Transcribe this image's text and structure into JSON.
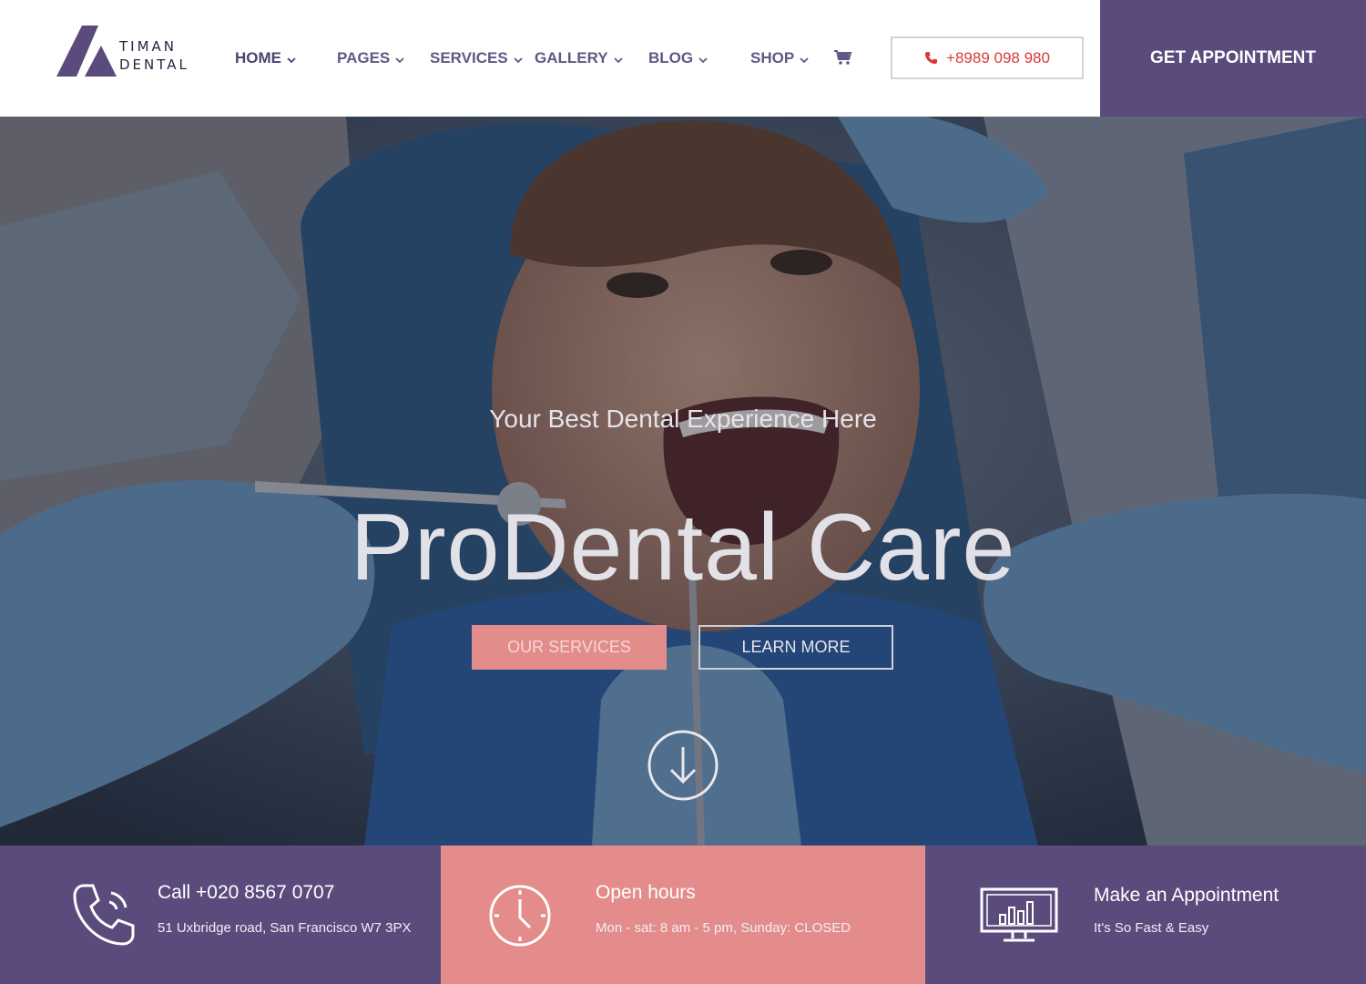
{
  "brand": {
    "line1": "TIMAN",
    "line2": "DENTAL"
  },
  "nav": {
    "items": [
      {
        "label": "HOME"
      },
      {
        "label": "PAGES"
      },
      {
        "label": "SERVICES"
      },
      {
        "label": "GALLERY"
      },
      {
        "label": "BLOG"
      },
      {
        "label": "SHOP"
      }
    ],
    "cart_icon": "cart-icon"
  },
  "header": {
    "phone": "+8989 098 980",
    "appointment_label": "GET APPOINTMENT"
  },
  "hero": {
    "subtitle": "Your Best Dental Experience Here",
    "title": "ProDental Care",
    "primary_button": "OUR SERVICES",
    "secondary_button": "LEARN MORE"
  },
  "info": {
    "call": {
      "title": "Call +020 8567 0707",
      "text": "51 Uxbridge road, San Francisco W7 3PX"
    },
    "hours": {
      "title": "Open hours",
      "text": "Mon - sat: 8 am - 5 pm, Sunday: CLOSED"
    },
    "appointment": {
      "title": "Make an Appointment",
      "text": "It's So Fast & Easy"
    }
  },
  "colors": {
    "brand_purple": "#5b4b7c",
    "accent_pink": "#e38c8b",
    "nav_text": "#5e5a84",
    "phone_red": "#d93a3a"
  }
}
